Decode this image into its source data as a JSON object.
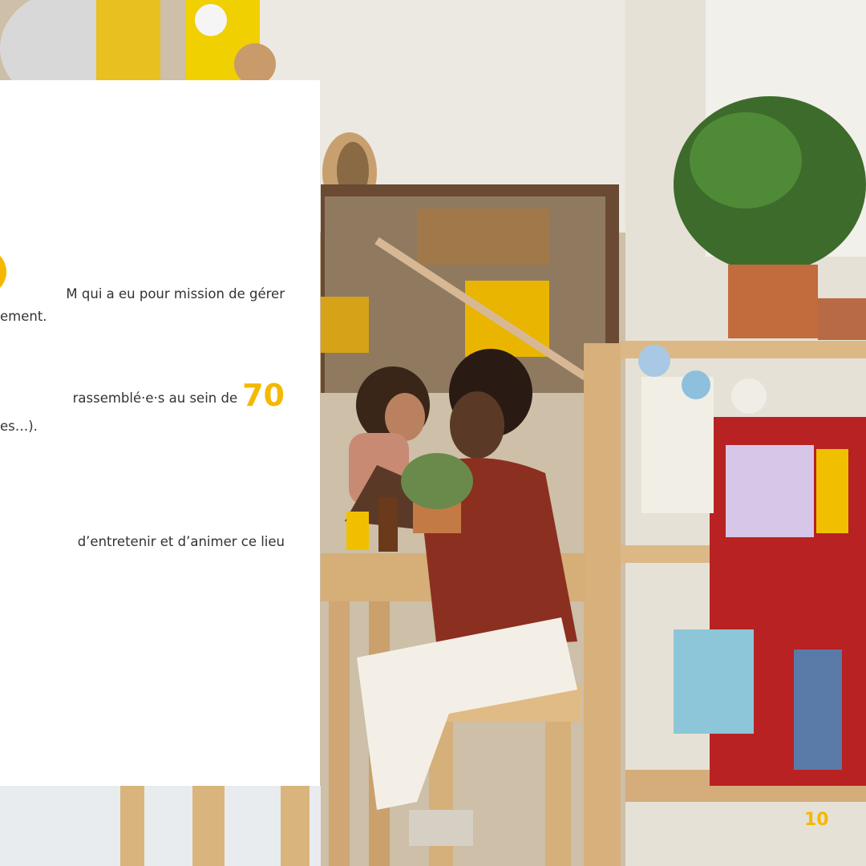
{
  "slide": {
    "para1": {
      "line1": "M qui a eu pour mission de gérer",
      "line2": "ement."
    },
    "para2": {
      "line1": "rassemblé·e·s au sein de",
      "highlight": "70",
      "line2": "es…)."
    },
    "para3": {
      "line1": "d’entretenir et d’animer ce lieu"
    },
    "page_number": "10"
  },
  "colors": {
    "accent": "#f5b800",
    "card_bg": "#ffffff",
    "text": "#333333"
  }
}
